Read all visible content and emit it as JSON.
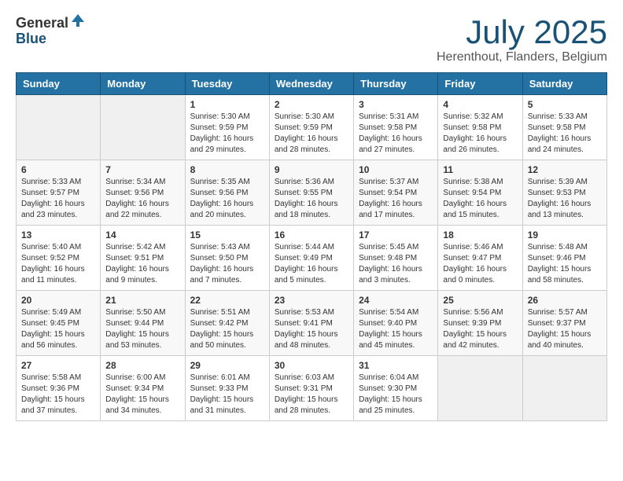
{
  "header": {
    "logo_general": "General",
    "logo_blue": "Blue",
    "month_title": "July 2025",
    "location": "Herenthout, Flanders, Belgium"
  },
  "weekdays": [
    "Sunday",
    "Monday",
    "Tuesday",
    "Wednesday",
    "Thursday",
    "Friday",
    "Saturday"
  ],
  "weeks": [
    [
      {
        "day": "",
        "info": ""
      },
      {
        "day": "",
        "info": ""
      },
      {
        "day": "1",
        "info": "Sunrise: 5:30 AM\nSunset: 9:59 PM\nDaylight: 16 hours and 29 minutes."
      },
      {
        "day": "2",
        "info": "Sunrise: 5:30 AM\nSunset: 9:59 PM\nDaylight: 16 hours and 28 minutes."
      },
      {
        "day": "3",
        "info": "Sunrise: 5:31 AM\nSunset: 9:58 PM\nDaylight: 16 hours and 27 minutes."
      },
      {
        "day": "4",
        "info": "Sunrise: 5:32 AM\nSunset: 9:58 PM\nDaylight: 16 hours and 26 minutes."
      },
      {
        "day": "5",
        "info": "Sunrise: 5:33 AM\nSunset: 9:58 PM\nDaylight: 16 hours and 24 minutes."
      }
    ],
    [
      {
        "day": "6",
        "info": "Sunrise: 5:33 AM\nSunset: 9:57 PM\nDaylight: 16 hours and 23 minutes."
      },
      {
        "day": "7",
        "info": "Sunrise: 5:34 AM\nSunset: 9:56 PM\nDaylight: 16 hours and 22 minutes."
      },
      {
        "day": "8",
        "info": "Sunrise: 5:35 AM\nSunset: 9:56 PM\nDaylight: 16 hours and 20 minutes."
      },
      {
        "day": "9",
        "info": "Sunrise: 5:36 AM\nSunset: 9:55 PM\nDaylight: 16 hours and 18 minutes."
      },
      {
        "day": "10",
        "info": "Sunrise: 5:37 AM\nSunset: 9:54 PM\nDaylight: 16 hours and 17 minutes."
      },
      {
        "day": "11",
        "info": "Sunrise: 5:38 AM\nSunset: 9:54 PM\nDaylight: 16 hours and 15 minutes."
      },
      {
        "day": "12",
        "info": "Sunrise: 5:39 AM\nSunset: 9:53 PM\nDaylight: 16 hours and 13 minutes."
      }
    ],
    [
      {
        "day": "13",
        "info": "Sunrise: 5:40 AM\nSunset: 9:52 PM\nDaylight: 16 hours and 11 minutes."
      },
      {
        "day": "14",
        "info": "Sunrise: 5:42 AM\nSunset: 9:51 PM\nDaylight: 16 hours and 9 minutes."
      },
      {
        "day": "15",
        "info": "Sunrise: 5:43 AM\nSunset: 9:50 PM\nDaylight: 16 hours and 7 minutes."
      },
      {
        "day": "16",
        "info": "Sunrise: 5:44 AM\nSunset: 9:49 PM\nDaylight: 16 hours and 5 minutes."
      },
      {
        "day": "17",
        "info": "Sunrise: 5:45 AM\nSunset: 9:48 PM\nDaylight: 16 hours and 3 minutes."
      },
      {
        "day": "18",
        "info": "Sunrise: 5:46 AM\nSunset: 9:47 PM\nDaylight: 16 hours and 0 minutes."
      },
      {
        "day": "19",
        "info": "Sunrise: 5:48 AM\nSunset: 9:46 PM\nDaylight: 15 hours and 58 minutes."
      }
    ],
    [
      {
        "day": "20",
        "info": "Sunrise: 5:49 AM\nSunset: 9:45 PM\nDaylight: 15 hours and 56 minutes."
      },
      {
        "day": "21",
        "info": "Sunrise: 5:50 AM\nSunset: 9:44 PM\nDaylight: 15 hours and 53 minutes."
      },
      {
        "day": "22",
        "info": "Sunrise: 5:51 AM\nSunset: 9:42 PM\nDaylight: 15 hours and 50 minutes."
      },
      {
        "day": "23",
        "info": "Sunrise: 5:53 AM\nSunset: 9:41 PM\nDaylight: 15 hours and 48 minutes."
      },
      {
        "day": "24",
        "info": "Sunrise: 5:54 AM\nSunset: 9:40 PM\nDaylight: 15 hours and 45 minutes."
      },
      {
        "day": "25",
        "info": "Sunrise: 5:56 AM\nSunset: 9:39 PM\nDaylight: 15 hours and 42 minutes."
      },
      {
        "day": "26",
        "info": "Sunrise: 5:57 AM\nSunset: 9:37 PM\nDaylight: 15 hours and 40 minutes."
      }
    ],
    [
      {
        "day": "27",
        "info": "Sunrise: 5:58 AM\nSunset: 9:36 PM\nDaylight: 15 hours and 37 minutes."
      },
      {
        "day": "28",
        "info": "Sunrise: 6:00 AM\nSunset: 9:34 PM\nDaylight: 15 hours and 34 minutes."
      },
      {
        "day": "29",
        "info": "Sunrise: 6:01 AM\nSunset: 9:33 PM\nDaylight: 15 hours and 31 minutes."
      },
      {
        "day": "30",
        "info": "Sunrise: 6:03 AM\nSunset: 9:31 PM\nDaylight: 15 hours and 28 minutes."
      },
      {
        "day": "31",
        "info": "Sunrise: 6:04 AM\nSunset: 9:30 PM\nDaylight: 15 hours and 25 minutes."
      },
      {
        "day": "",
        "info": ""
      },
      {
        "day": "",
        "info": ""
      }
    ]
  ]
}
